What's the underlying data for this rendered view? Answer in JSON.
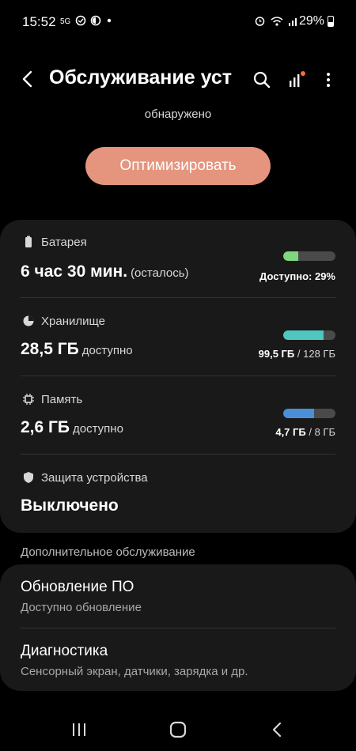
{
  "status_bar": {
    "time": "15:52",
    "battery_pct": "29%",
    "icons": [
      "sim-icon",
      "data-saver-icon",
      "night-icon",
      "dot-icon",
      "alarm-icon",
      "wifi-icon",
      "signal-icon",
      "battery-icon"
    ]
  },
  "header": {
    "title": "Обслуживание уст",
    "back_icon": "back-arrow-icon",
    "search_icon": "search-icon",
    "stats_icon": "chart-icon",
    "more_icon": "more-vert-icon",
    "stats_badge_color": "#ff6b3d"
  },
  "top_note": "обнаружено",
  "optimize_button": "Оптимизировать",
  "status_card": {
    "battery": {
      "label": "Батарея",
      "value": "6 час 30 мин.",
      "value_sub": "(осталось)",
      "meta_bold": "Доступно: 29%",
      "fill_fraction": 0.29,
      "color": "#7fd67d"
    },
    "storage": {
      "label": "Хранилище",
      "value": "28,5 ГБ",
      "value_sub": "доступно",
      "meta_bold": "99,5 ГБ",
      "meta_rest": " / 128 ГБ",
      "fill_fraction": 0.78,
      "color": "#4fc6c0"
    },
    "memory": {
      "label": "Память",
      "value": "2,6 ГБ",
      "value_sub": "доступно",
      "meta_bold": "4,7 ГБ",
      "meta_rest": " / 8 ГБ",
      "fill_fraction": 0.59,
      "color": "#4a8fd8"
    },
    "security": {
      "label": "Защита устройства",
      "value": "Выключено"
    }
  },
  "extra_section": {
    "label": "Дополнительное обслуживание",
    "items": [
      {
        "title": "Обновление ПО",
        "subtitle": "Доступно обновление"
      },
      {
        "title": "Диагностика",
        "subtitle": "Сенсорный экран, датчики, зарядка и др."
      }
    ]
  },
  "nav_bar": {
    "recents": "recents-icon",
    "home": "home-icon",
    "back": "nav-back-icon"
  }
}
